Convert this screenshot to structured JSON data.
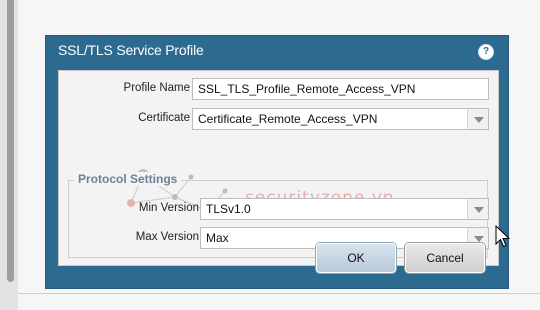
{
  "dialog": {
    "title": "SSL/TLS Service Profile",
    "help_icon": "help-icon",
    "profile_name": {
      "label": "Profile Name",
      "value": "SSL_TLS_Profile_Remote_Access_VPN"
    },
    "certificate": {
      "label": "Certificate",
      "value": "Certificate_Remote_Access_VPN"
    },
    "protocol_settings": {
      "legend": "Protocol Settings",
      "min_version": {
        "label": "Min Version",
        "value": "TLSv1.0"
      },
      "max_version": {
        "label": "Max Version",
        "value": "Max"
      }
    },
    "buttons": {
      "ok": "OK",
      "cancel": "Cancel"
    }
  },
  "watermark": {
    "text": "securityzone.vn"
  },
  "colors": {
    "dialog_header": "#2d6a8f",
    "dialog_body": "#f3f3f3",
    "legend_text": "#6b8298",
    "watermark": "#e9a3a3"
  }
}
